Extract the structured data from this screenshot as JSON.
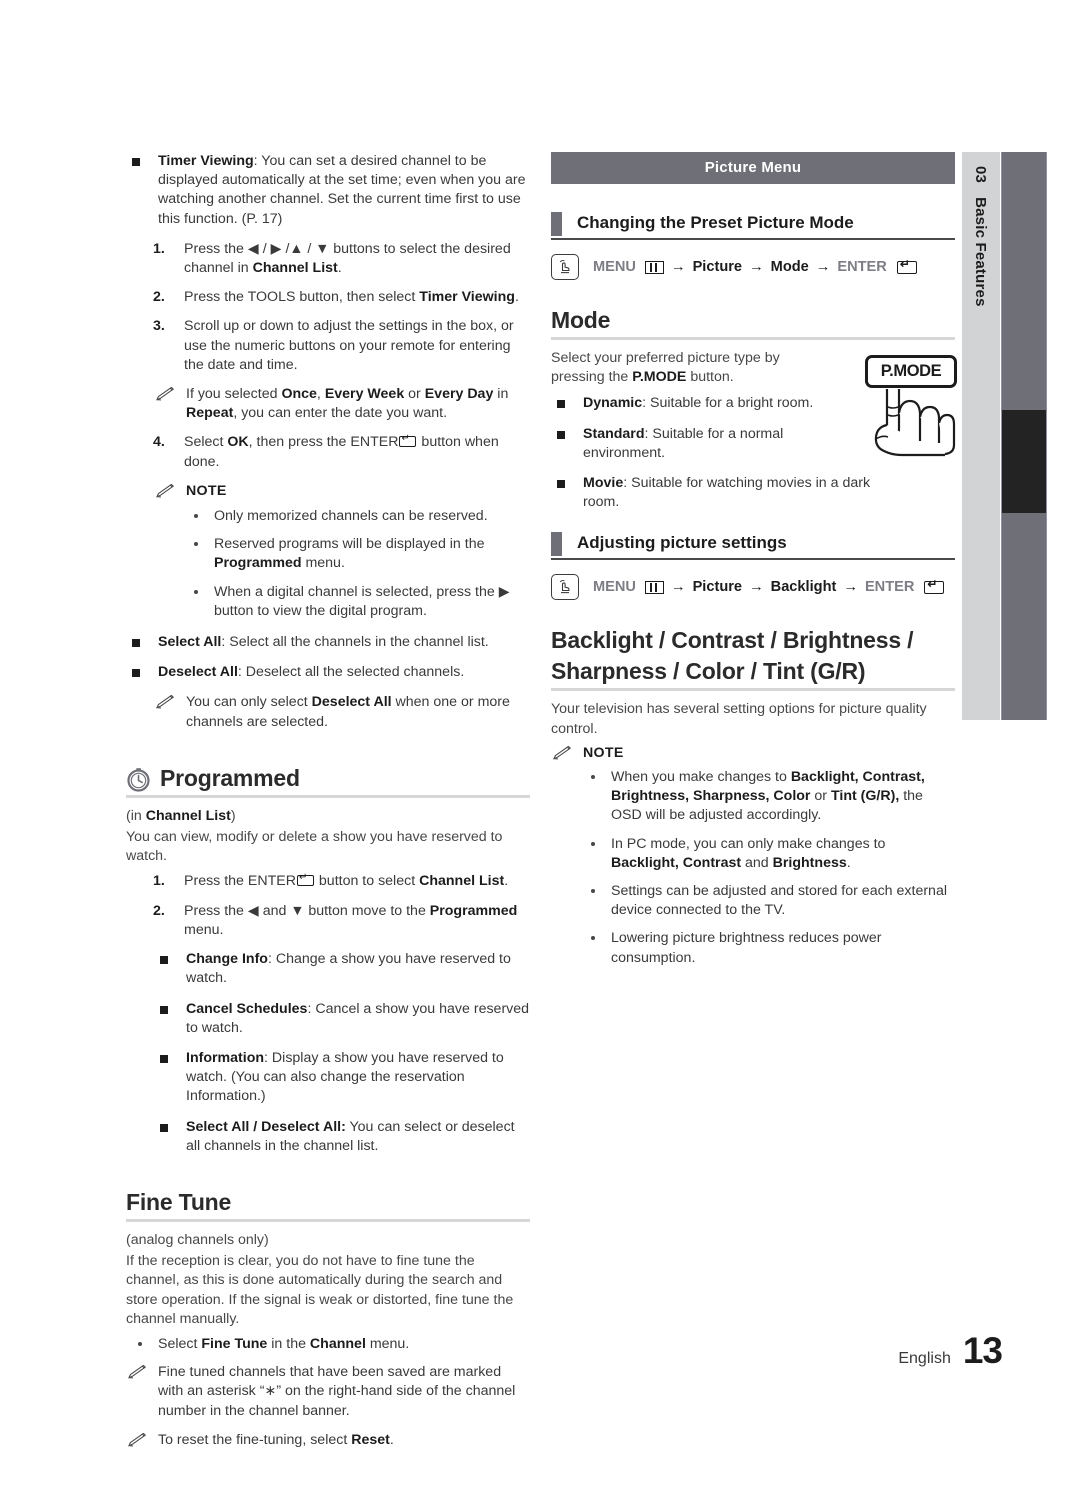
{
  "page": {
    "language": "English",
    "number": "13"
  },
  "side_tab": {
    "chapter_number": "03",
    "chapter_title": "Basic Features"
  },
  "left_column": {
    "timer_viewing": {
      "term": "Timer Viewing",
      "desc": ": You can set a desired channel to be displayed automatically at the set time; even when you are watching another channel. Set the current time first to use this function. (P. 17)",
      "steps": [
        {
          "num": "1.",
          "pre": "Press the ◀ / ▶ /▲ / ▼ buttons to select the desired channel in ",
          "bold": "Channel List",
          "post": "."
        },
        {
          "num": "2.",
          "pre": "Press the TOOLS button, then select ",
          "bold": "Timer Viewing",
          "post": "."
        },
        {
          "num": "3.",
          "pre": "Scroll up or down to adjust the settings in the box, or use the numeric buttons on your remote for entering the date and time.",
          "bold": "",
          "post": ""
        }
      ],
      "step3_note": {
        "t1": "If you selected ",
        "b1": "Once",
        "t2": ", ",
        "b2": "Every Week",
        "t3": " or ",
        "b3": "Every Day",
        "t4": " in ",
        "b4": "Repeat",
        "t5": ", you can enter the date you want."
      },
      "step4": {
        "num": "4.",
        "t1": "Select ",
        "b1": "OK",
        "t2": ", then press the ENTER",
        "t3": " button when done."
      },
      "note_label": "NOTE",
      "notes": [
        {
          "t1": "Only memorized channels can be reserved.",
          "b1": "",
          "t2": ""
        },
        {
          "t1": "Reserved programs will be displayed in the ",
          "b1": "Programmed",
          "t2": " menu."
        },
        {
          "t1": "When a digital channel is selected, press the ▶ button to view the digital program.",
          "b1": "",
          "t2": ""
        }
      ]
    },
    "select_all": {
      "term": "Select All",
      "desc": ": Select all the channels in the channel list."
    },
    "deselect_all": {
      "term": "Deselect All",
      "desc": ": Deselect all the selected channels."
    },
    "deselect_note": {
      "t1": "You can only select ",
      "b1": "Deselect All",
      "t2": " when one or more channels are selected."
    },
    "programmed": {
      "heading": "Programmed",
      "subtitle_pre": "(in ",
      "subtitle_bold": "Channel List",
      "subtitle_post": ")",
      "intro": "You can view, modify or delete a show you have reserved to watch.",
      "steps": [
        {
          "num": "1.",
          "pre": "Press the ENTER",
          "mid": " button to select ",
          "bold": "Channel List",
          "post": "."
        },
        {
          "num": "2.",
          "pre": "Press the ◀ and ▼ button move to the ",
          "bold": "Programmed",
          "post": " menu."
        }
      ],
      "items": [
        {
          "term": "Change Info",
          "desc": ": Change a show you have reserved to watch."
        },
        {
          "term": "Cancel Schedules",
          "desc": ": Cancel a show you have reserved to watch."
        },
        {
          "term": "Information",
          "desc": ": Display a show you have reserved to watch. (You can also change the reservation Information.)"
        },
        {
          "term": "Select All / Deselect All:",
          "desc": " You can select or deselect all channels in the channel list."
        }
      ]
    },
    "fine_tune": {
      "heading": "Fine Tune",
      "subtitle": "(analog channels only)",
      "intro": "If the reception is clear, you do not have to fine tune the channel, as this is done automatically during the search and store operation. If the signal is weak or distorted, fine tune the channel manually.",
      "bullet": {
        "t1": "Select ",
        "b1": "Fine Tune",
        "t2": " in the ",
        "b2": "Channel",
        "t3": " menu."
      },
      "note1": "Fine tuned channels that have been saved are marked with an asterisk “∗” on the right-hand side of the channel number in the channel banner.",
      "note2_t1": "To reset the fine-tuning, select ",
      "note2_b1": "Reset",
      "note2_t2": "."
    }
  },
  "right_column": {
    "banner": "Picture Menu",
    "section1": {
      "title": "Changing the Preset Picture Mode",
      "path": {
        "menu": "MENU",
        "arrow1": "→",
        "item1": "Picture",
        "arrow2": "→",
        "item2": "Mode",
        "arrow3": "→",
        "enter": "ENTER"
      },
      "heading": "Mode",
      "intro_pre": "Select your preferred picture type by pressing the ",
      "intro_bold": "P.MODE",
      "intro_post": " button.",
      "modes": [
        {
          "term": "Dynamic",
          "desc": ": Suitable for a bright room."
        },
        {
          "term": "Standard",
          "desc": ": Suitable for a normal environment."
        },
        {
          "term": "Movie",
          "desc": ": Suitable for watching movies in a dark room."
        }
      ],
      "remote_button_label": "P.MODE"
    },
    "section2": {
      "title": "Adjusting picture settings",
      "path": {
        "menu": "MENU",
        "arrow1": "→",
        "item1": "Picture",
        "arrow2": "→",
        "item2": "Backlight",
        "arrow3": "→",
        "enter": "ENTER"
      },
      "heading_line1": "Backlight / Contrast / Brightness /",
      "heading_line2": "Sharpness / Color / Tint (G/R)",
      "intro": "Your television has several setting options for picture quality control.",
      "note_label": "NOTE",
      "notes": [
        {
          "t1": "When you make changes to ",
          "b1": "Backlight, Contrast, Brightness, Sharpness, Color",
          "t2": " or ",
          "b2": "Tint (G/R),",
          "t3": " the OSD will be adjusted accordingly."
        },
        {
          "t1": "In PC mode, you can only make changes to ",
          "b1": "Backlight, Contrast",
          "t2": " and ",
          "b2": "Brightness",
          "t3": "."
        },
        {
          "t1": "Settings can be adjusted and stored for each external device connected to the TV.",
          "b1": "",
          "t2": "",
          "b2": "",
          "t3": ""
        },
        {
          "t1": "Lowering picture brightness reduces power consumption.",
          "b1": "",
          "t2": "",
          "b2": "",
          "t3": ""
        }
      ]
    }
  },
  "colors": {
    "banner_grey": "#6f7077",
    "tab_light": "#d2d3d5",
    "tab_dark": "#6f7077",
    "tab_active": "#232323",
    "body_text": "#48484a",
    "bold_text": "#1c1c1c"
  }
}
